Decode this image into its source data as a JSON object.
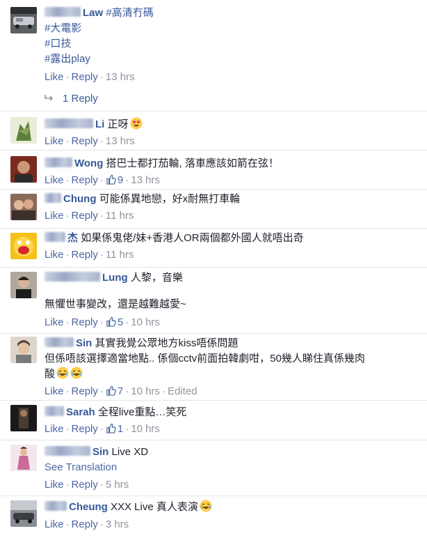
{
  "comments": [
    {
      "name": "Law",
      "lines": [
        "#高清冇碼",
        "#大電影",
        "#口技",
        "#露出play"
      ],
      "actions": {
        "like": "Like",
        "reply": "Reply",
        "time": "13 hrs"
      },
      "replies_label": "1 Reply"
    },
    {
      "name": "Li",
      "text": "正呀",
      "actions": {
        "like": "Like",
        "reply": "Reply",
        "time": "13 hrs"
      }
    },
    {
      "name": "Wong",
      "text": "搭巴士都打茄輪, 落車應該如箭在弦！",
      "actions": {
        "like": "Like",
        "reply": "Reply",
        "likes": "9",
        "time": "13 hrs"
      }
    },
    {
      "name": "Chung",
      "text": "可能係異地戀，好x耐無打車輪",
      "actions": {
        "like": "Like",
        "reply": "Reply",
        "time": "11 hrs"
      }
    },
    {
      "name": "杰",
      "text": "如果係鬼佬/妹+香港人OR兩個都外國人就唔出奇",
      "actions": {
        "like": "Like",
        "reply": "Reply",
        "time": "11 hrs"
      }
    },
    {
      "name": "Lung",
      "text": "人黎，音樂",
      "text2": "無懼世事變改，還是越難越愛~",
      "actions": {
        "like": "Like",
        "reply": "Reply",
        "likes": "5",
        "time": "10 hrs"
      }
    },
    {
      "name": "Sin",
      "text": "其實我覺公眾地方kiss唔係問題",
      "text2": "但係唔該選擇適當地點.. 係個cctv前面拍韓劇咁，50幾人睇住真係幾肉",
      "text3": "酸",
      "actions": {
        "like": "Like",
        "reply": "Reply",
        "likes": "7",
        "time": "10 hrs",
        "edited": "Edited"
      }
    },
    {
      "name": "Sarah",
      "text": "全程live重點…笑死",
      "actions": {
        "like": "Like",
        "reply": "Reply",
        "likes": "1",
        "time": "10 hrs"
      }
    },
    {
      "name": "Sin",
      "text": "Live XD",
      "translation": "See Translation",
      "actions": {
        "like": "Like",
        "reply": "Reply",
        "time": "5 hrs"
      }
    },
    {
      "name": "Cheung",
      "text": "XXX Live 真人表演",
      "actions": {
        "like": "Like",
        "reply": "Reply",
        "time": "3 hrs"
      }
    }
  ]
}
